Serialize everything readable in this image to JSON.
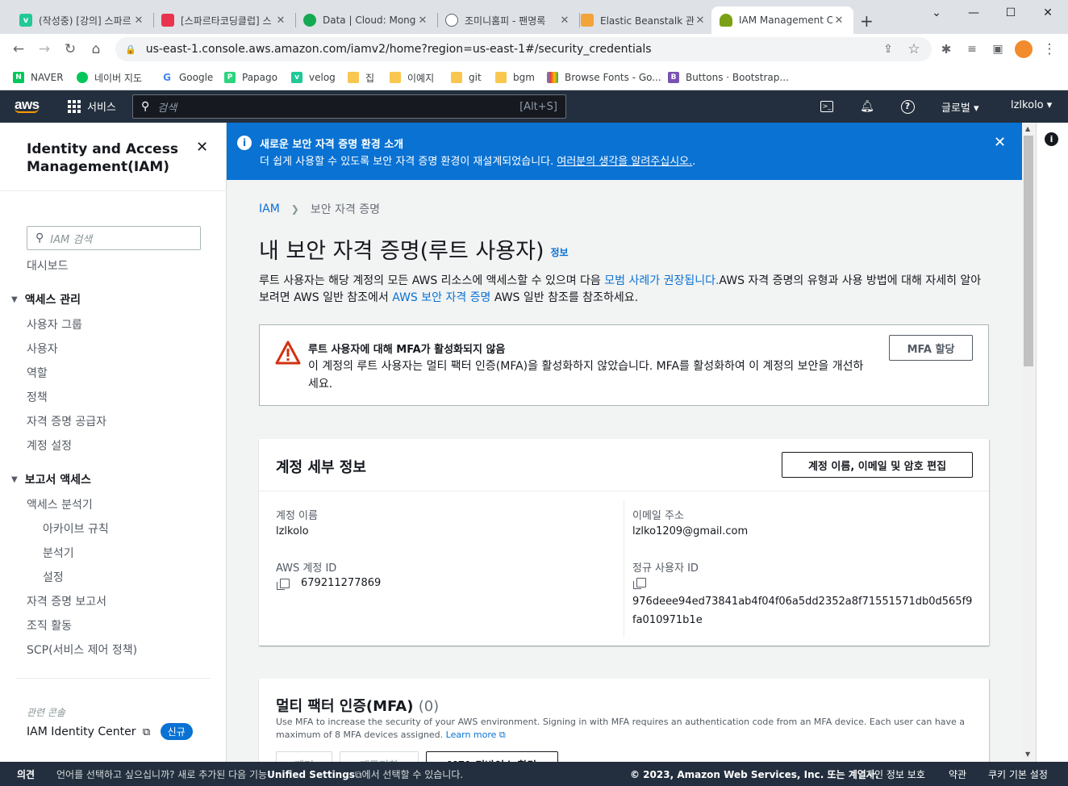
{
  "browser": {
    "tabs": [
      {
        "title": "(작성중) [강의] 스파르",
        "fav_color": "#20c997",
        "fav_text": "v"
      },
      {
        "title": "[스파르타코딩클럽] 스",
        "fav_color": "#e8344e",
        "fav_text": ""
      },
      {
        "title": "Data | Cloud: Mongo",
        "fav_color": "#13aa52",
        "fav_text": ""
      },
      {
        "title": "조미니홈피 - 팬명록",
        "fav_color": "#5f6368",
        "fav_text": ""
      },
      {
        "title": "Elastic Beanstalk 관리",
        "fav_color": "#f2a33a",
        "fav_text": ""
      },
      {
        "title": "IAM Management C",
        "fav_color": "#7aa116",
        "fav_text": ""
      }
    ],
    "url": "us-east-1.console.aws.amazon.com/iamv2/home?region=us-east-1#/security_credentials",
    "bookmarks": [
      {
        "label": "NAVER",
        "icon": "naver-icon",
        "color": "#03c75a"
      },
      {
        "label": "네이버 지도",
        "icon": "naver-map-icon",
        "color": "#03c75a"
      },
      {
        "label": "Google",
        "icon": "google-icon",
        "color": "#4285f4"
      },
      {
        "label": "Papago",
        "icon": "papago-icon",
        "color": "#2bd57e"
      },
      {
        "label": "velog",
        "icon": "velog-icon",
        "color": "#20c997"
      },
      {
        "label": "집",
        "icon": "folder-icon",
        "color": "#f9c74f"
      },
      {
        "label": "이예지",
        "icon": "folder-icon",
        "color": "#f9c74f"
      },
      {
        "label": "git",
        "icon": "folder-icon",
        "color": "#f9c74f"
      },
      {
        "label": "bgm",
        "icon": "folder-icon",
        "color": "#f9c74f"
      },
      {
        "label": "Browse Fonts - Go...",
        "icon": "google-fonts-icon",
        "color": "#4285f4"
      },
      {
        "label": "Buttons · Bootstrap...",
        "icon": "bootstrap-icon",
        "color": "#7952b3"
      }
    ]
  },
  "aws_nav": {
    "logo": "aws",
    "services": "서비스",
    "search_placeholder": "검색",
    "search_shortcut": "[Alt+S]",
    "region": "글로벌",
    "user": "lzlkolo"
  },
  "sidebar": {
    "title": "Identity and Access Management(IAM)",
    "search_placeholder": "IAM 검색",
    "dashboard": "대시보드",
    "access_mgmt": {
      "header": "액세스 관리",
      "items": [
        "사용자 그룹",
        "사용자",
        "역할",
        "정책",
        "자격 증명 공급자",
        "계정 설정"
      ]
    },
    "access_reports": {
      "header": "보고서 액세스",
      "analyzer": "액세스 분석기",
      "sub": [
        "아카이브 규칙",
        "분석기",
        "설정"
      ],
      "items": [
        "자격 증명 보고서",
        "조직 활동",
        "SCP(서비스 제어 정책)"
      ]
    },
    "related": "관련 콘솔",
    "identity_center": "IAM Identity Center",
    "new_badge": "신규"
  },
  "flash": {
    "title": "새로운 보안 자격 증명 환경 소개",
    "body": "더 쉽게 사용할 수 있도록 보안 자격 증명 환경이 재설계되었습니다. ",
    "link": "여러분의 생각을 알려주십시오.",
    "tail": "."
  },
  "breadcrumb": {
    "root": "IAM",
    "current": "보안 자격 증명"
  },
  "page": {
    "title": "내 보안 자격 증명(루트 사용자)",
    "info": "정보",
    "desc_1": "루트 사용자는 해당 계정의 모든 AWS 리소스에 액세스할 수 있으며 다음 ",
    "desc_link1": "모범 사례가 권장됩니다.",
    "desc_2": "AWS 자격 증명의 유형과 사용 방법에 대해 자세히 알아보려면 AWS 일반 참조에서 ",
    "desc_link2": "AWS 보안 자격 증명",
    "desc_3": " AWS 일반 참조를 참조하세요."
  },
  "alert": {
    "title": "루트 사용자에 대해 MFA가 활성화되지 않음",
    "body": "이 계정의 루트 사용자는 멀티 팩터 인증(MFA)을 활성화하지 않았습니다. MFA를 활성화하여 이 계정의 보안을 개선하세요.",
    "button": "MFA 할당"
  },
  "account": {
    "header": "계정 세부 정보",
    "edit_button": "계정 이름, 이메일 및 암호 편집",
    "name_label": "계정 이름",
    "name": "lzlkolo",
    "email_label": "이메일 주소",
    "email": "lzlko1209@gmail.com",
    "id_label": "AWS 계정 ID",
    "id": "679211277869",
    "canonical_label": "정규 사용자 ID",
    "canonical_1": "976deee94ed73841ab4f04f06a5dd2352a8f71551571db0d565f9",
    "canonical_2": "fa010971b1e"
  },
  "mfa": {
    "header": "멀티 팩터 인증(MFA)",
    "count": "(0)",
    "desc": "Use MFA to increase the security of your AWS environment. Signing in with MFA requires an authentication code from an MFA device. Each user can have a maximum of 8 MFA devices assigned.",
    "learn_more": "Learn more",
    "buttons": [
      "제거",
      "재동기화",
      "MFA 디바이스 할당"
    ]
  },
  "footer": {
    "feedback": "의견",
    "lang_1": "언어를 선택하고 싶으십니까? 새로 추가된 다음 기능",
    "lang_bold": "Unified Settings",
    "lang_2": "에서 선택할 수 있습니다.",
    "copyright": "© 2023, Amazon Web Services, Inc. 또는 계열사.",
    "privacy": "개인 정보 보호",
    "terms": "약관",
    "cookies": "쿠키 기본 설정"
  }
}
